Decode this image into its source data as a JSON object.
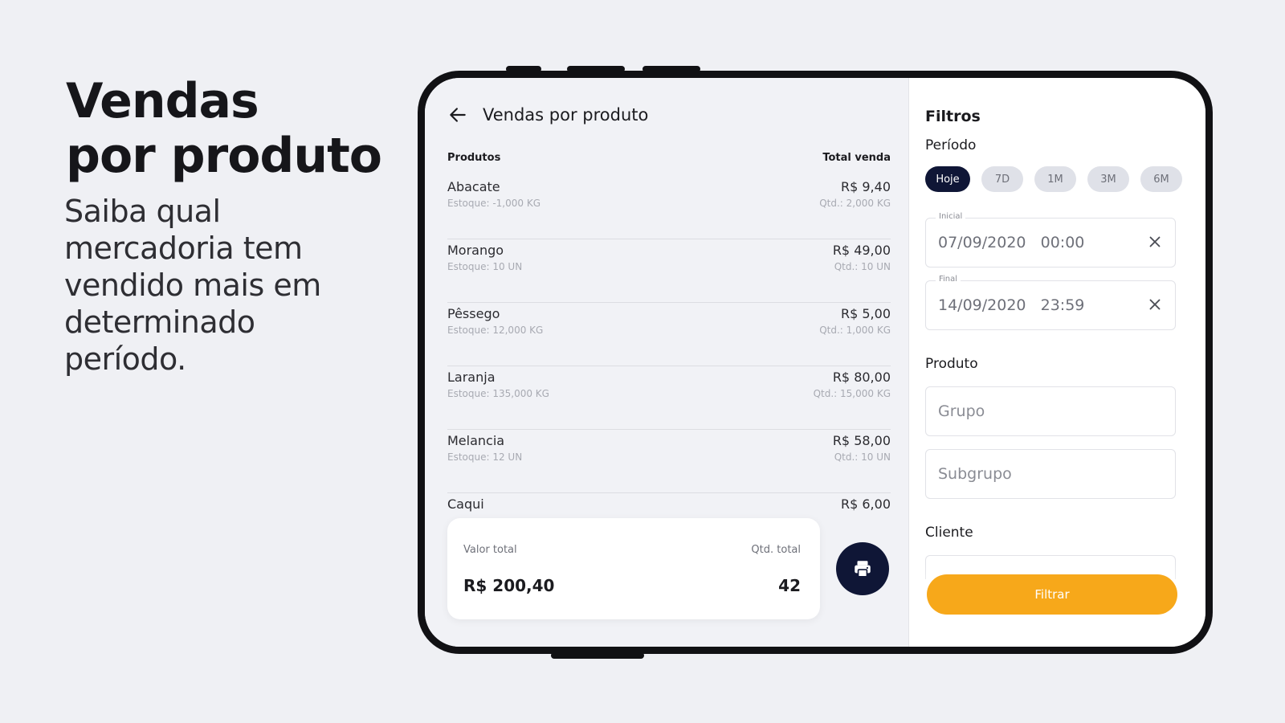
{
  "hero": {
    "title": "Vendas\npor produto",
    "subtitle": "Saiba qual mercadoria tem vendido mais em determinado período."
  },
  "header": {
    "title": "Vendas por produto",
    "back_icon": "arrow-left-icon"
  },
  "table": {
    "col_products": "Produtos",
    "col_total": "Total venda",
    "rows": [
      {
        "name": "Abacate",
        "stock": "Estoque: -1,000 KG",
        "price": "R$ 9,40",
        "qty": "Qtd.: 2,000 KG"
      },
      {
        "name": "Morango",
        "stock": "Estoque: 10 UN",
        "price": "R$ 49,00",
        "qty": "Qtd.: 10 UN"
      },
      {
        "name": "Pêssego",
        "stock": "Estoque: 12,000 KG",
        "price": "R$ 5,00",
        "qty": "Qtd.: 1,000 KG"
      },
      {
        "name": "Laranja",
        "stock": "Estoque: 135,000 KG",
        "price": "R$ 80,00",
        "qty": "Qtd.: 15,000 KG"
      },
      {
        "name": "Melancia",
        "stock": "Estoque: 12 UN",
        "price": "R$ 58,00",
        "qty": "Qtd.: 10 UN"
      },
      {
        "name": "Caqui",
        "stock": "",
        "price": "R$ 6,00",
        "qty": ""
      }
    ]
  },
  "summary": {
    "total_label": "Valor total",
    "total_value": "R$ 200,40",
    "qty_label": "Qtd. total",
    "qty_value": "42",
    "print_icon": "printer-icon"
  },
  "filters": {
    "title": "Filtros",
    "period_label": "Período",
    "chips": [
      "Hoje",
      "7D",
      "1M",
      "3M",
      "6M"
    ],
    "active_chip": "Hoje",
    "start": {
      "label": "Inicial",
      "value": "07/09/2020   00:00"
    },
    "end": {
      "label": "Final",
      "value": "14/09/2020   23:59"
    },
    "product_label": "Produto",
    "group_placeholder": "Grupo",
    "subgroup_placeholder": "Subgrupo",
    "client_label": "Cliente",
    "submit_label": "Filtrar"
  },
  "colors": {
    "primary_dark": "#0f1636",
    "accent": "#f7a81a",
    "background": "#eff0f4"
  }
}
